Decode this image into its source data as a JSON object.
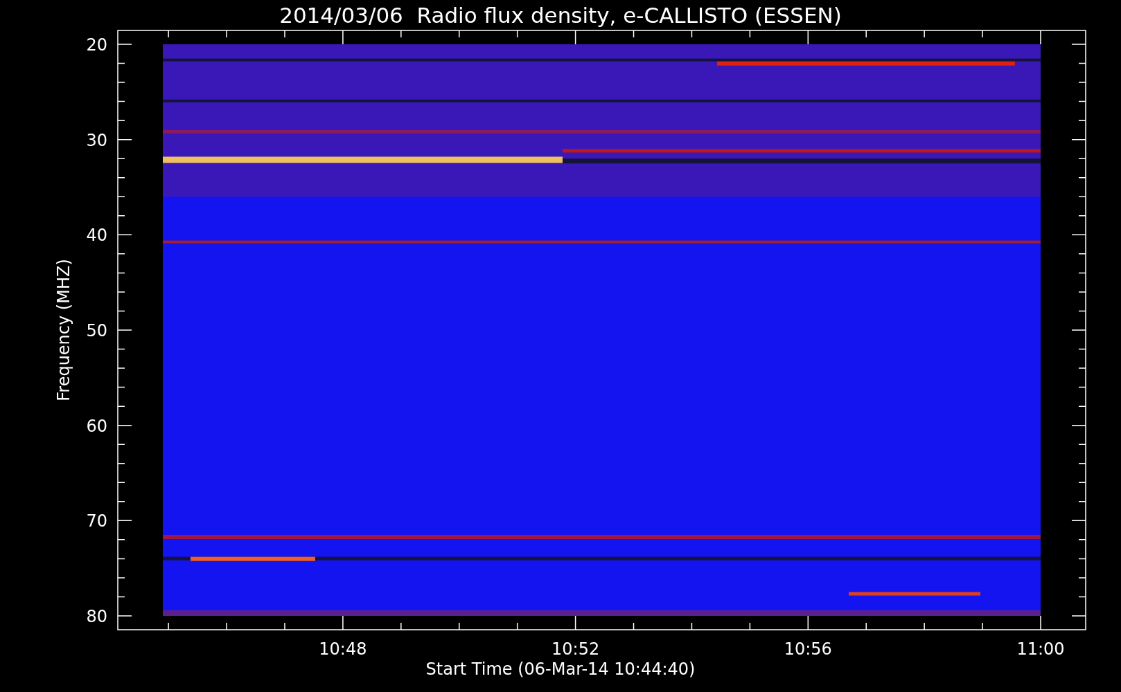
{
  "title": "2014/03/06  Radio flux density, e-CALLISTO (ESSEN)",
  "y_axis": {
    "label": "Frequency (MHZ)",
    "ticks": [
      "20",
      "30",
      "40",
      "50",
      "60",
      "70",
      "80"
    ]
  },
  "x_axis": {
    "label": "Start Time (06-Mar-14 10:44:40)",
    "ticks": [
      "10:48",
      "10:52",
      "10:56",
      "11:00"
    ]
  }
}
